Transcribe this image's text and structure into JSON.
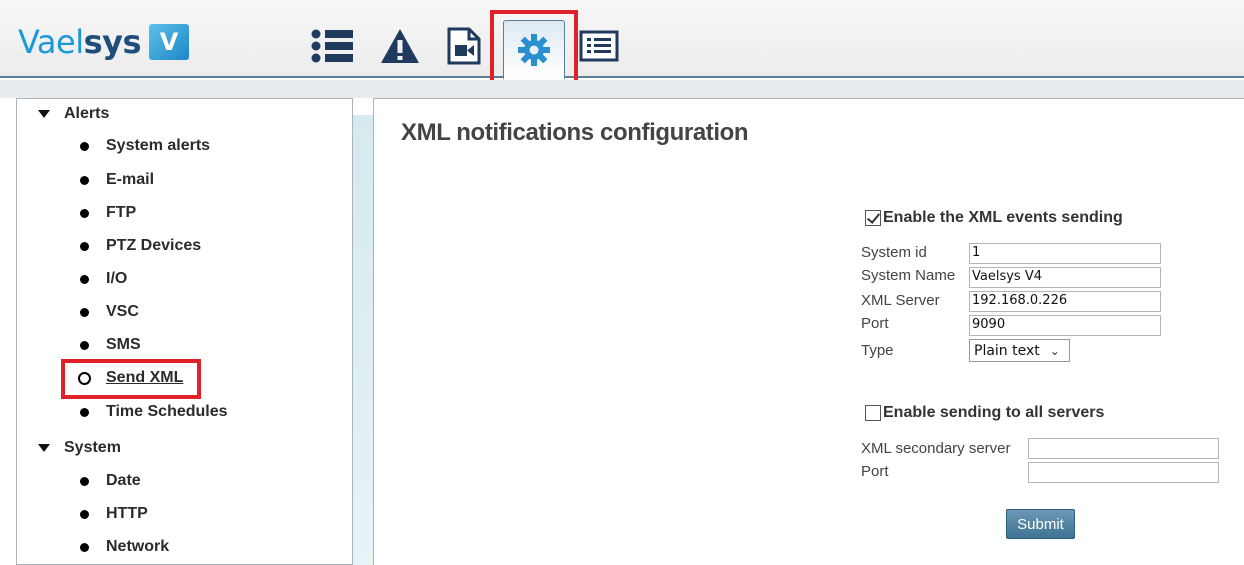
{
  "app": {
    "logo_part1": "Vael",
    "logo_part2": "sys",
    "logo_badge": "V4"
  },
  "toolbar": {
    "icons": [
      "list-icon",
      "warning-icon",
      "video-file-icon",
      "gear-icon",
      "log-list-icon"
    ],
    "active": "gear-icon",
    "highlight_color": "#e0212a"
  },
  "sidebar": {
    "sections": [
      {
        "label": "Alerts",
        "items": [
          "System alerts",
          "E-mail",
          "FTP",
          "PTZ Devices",
          "I/O",
          "VSC",
          "SMS",
          "Send XML",
          "Time Schedules"
        ]
      },
      {
        "label": "System",
        "items": [
          "Date",
          "HTTP",
          "Network"
        ]
      }
    ],
    "selected": "Send XML"
  },
  "main": {
    "title": "XML notifications configuration",
    "enable_xml": {
      "label": "Enable the XML events sending",
      "checked": true
    },
    "fields": {
      "system_id": {
        "label": "System id",
        "value": "1"
      },
      "system_name": {
        "label": "System Name",
        "value": "Vaelsys V4"
      },
      "xml_server": {
        "label": "XML Server",
        "value": "192.168.0.226"
      },
      "port": {
        "label": "Port",
        "value": "9090"
      },
      "type": {
        "label": "Type",
        "value": "Plain text"
      }
    },
    "enable_all": {
      "label": "Enable sending to all servers",
      "checked": false
    },
    "secondary": {
      "server": {
        "label": "XML secondary server",
        "value": ""
      },
      "port": {
        "label": "Port",
        "value": ""
      }
    },
    "submit_label": "Submit"
  }
}
